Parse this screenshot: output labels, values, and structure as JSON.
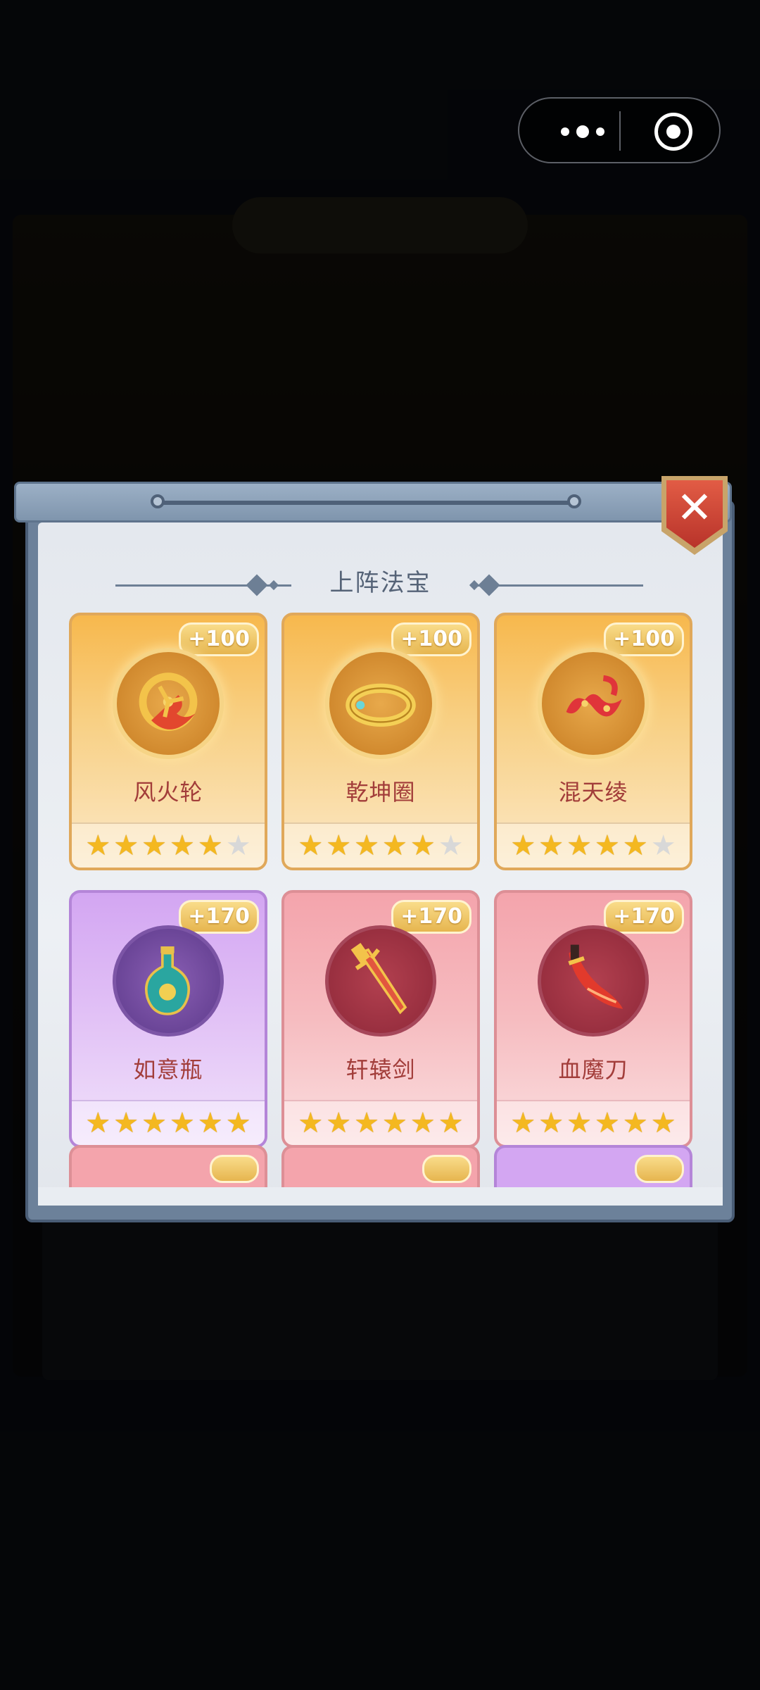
{
  "dialog": {
    "title": "上阵法宝",
    "close_icon": "close-x-icon"
  },
  "treasures": [
    {
      "name": "风火轮",
      "bonus": "+100",
      "stars": 5,
      "max_stars": 6,
      "theme": "gold",
      "icon": "wind-fire-wheel-icon"
    },
    {
      "name": "乾坤圈",
      "bonus": "+100",
      "stars": 5,
      "max_stars": 6,
      "theme": "gold",
      "icon": "qiankun-ring-icon"
    },
    {
      "name": "混天绫",
      "bonus": "+100",
      "stars": 5,
      "max_stars": 6,
      "theme": "gold",
      "icon": "red-silk-sash-icon"
    },
    {
      "name": "如意瓶",
      "bonus": "+170",
      "stars": 6,
      "max_stars": 6,
      "theme": "purple",
      "icon": "ruyi-vase-icon"
    },
    {
      "name": "轩辕剑",
      "bonus": "+170",
      "stars": 6,
      "max_stars": 6,
      "theme": "red",
      "icon": "xuanyuan-sword-icon"
    },
    {
      "name": "血魔刀",
      "bonus": "+170",
      "stars": 6,
      "max_stars": 6,
      "theme": "red",
      "icon": "blood-demon-blade-icon"
    }
  ],
  "partial_row_themes": [
    "red",
    "red",
    "purple"
  ],
  "colors": {
    "gold_card": "#f8cf82",
    "purple_card": "#e2c2f6",
    "red_card": "#f6bcc0",
    "name_text": "#a23d3a",
    "star": "#f4b820"
  }
}
